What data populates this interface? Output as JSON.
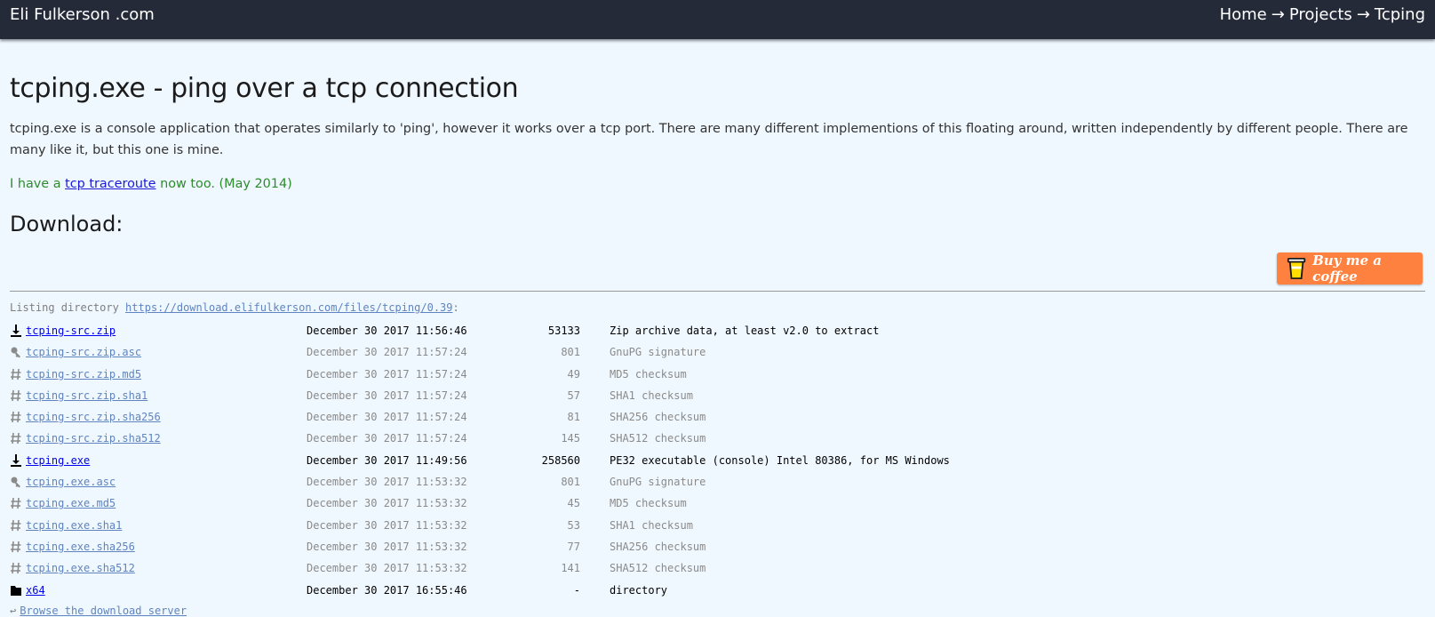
{
  "header": {
    "site_name": "Eli Fulkerson .com",
    "breadcrumbs": [
      "Home",
      "Projects",
      "Tcping"
    ],
    "separator": "→"
  },
  "page": {
    "title": "tcping.exe - ping over a tcp connection",
    "intro": "tcping.exe is a console application that operates similarly to 'ping', however it works over a tcp port. There are many different implementions of this floating around, written independently by different people. There are many like it, but this one is mine.",
    "note_prefix": "I have a ",
    "note_link": "tcp traceroute",
    "note_suffix": " now too. (May 2014)",
    "download_heading": "Download:",
    "coffee_label": "Buy me a coffee"
  },
  "listing": {
    "prefix": "Listing directory ",
    "url": "https://download.elifulkerson.com/files/tcping/0.39",
    "suffix": ":",
    "browse_arrow": "↩",
    "browse_label": "Browse the download server"
  },
  "files": [
    {
      "icon": "download-icon",
      "name": "tcping-src.zip",
      "date": "December 30 2017 11:56:46",
      "size": "53133",
      "desc": "Zip archive data, at least v2.0 to extract",
      "kind": "primary"
    },
    {
      "icon": "key-icon",
      "name": "tcping-src.zip.asc",
      "date": "December 30 2017 11:57:24",
      "size": "801",
      "desc": "GnuPG signature",
      "kind": "secondary"
    },
    {
      "icon": "hash-icon",
      "name": "tcping-src.zip.md5",
      "date": "December 30 2017 11:57:24",
      "size": "49",
      "desc": "MD5 checksum",
      "kind": "secondary"
    },
    {
      "icon": "hash-icon",
      "name": "tcping-src.zip.sha1",
      "date": "December 30 2017 11:57:24",
      "size": "57",
      "desc": "SHA1 checksum",
      "kind": "secondary"
    },
    {
      "icon": "hash-icon",
      "name": "tcping-src.zip.sha256",
      "date": "December 30 2017 11:57:24",
      "size": "81",
      "desc": "SHA256 checksum",
      "kind": "secondary"
    },
    {
      "icon": "hash-icon",
      "name": "tcping-src.zip.sha512",
      "date": "December 30 2017 11:57:24",
      "size": "145",
      "desc": "SHA512 checksum",
      "kind": "secondary"
    },
    {
      "icon": "download-icon",
      "name": "tcping.exe",
      "date": "December 30 2017 11:49:56",
      "size": "258560",
      "desc": "PE32 executable (console) Intel 80386, for MS Windows",
      "kind": "primary"
    },
    {
      "icon": "key-icon",
      "name": "tcping.exe.asc",
      "date": "December 30 2017 11:53:32",
      "size": "801",
      "desc": "GnuPG signature",
      "kind": "secondary"
    },
    {
      "icon": "hash-icon",
      "name": "tcping.exe.md5",
      "date": "December 30 2017 11:53:32",
      "size": "45",
      "desc": "MD5 checksum",
      "kind": "secondary"
    },
    {
      "icon": "hash-icon",
      "name": "tcping.exe.sha1",
      "date": "December 30 2017 11:53:32",
      "size": "53",
      "desc": "SHA1 checksum",
      "kind": "secondary"
    },
    {
      "icon": "hash-icon",
      "name": "tcping.exe.sha256",
      "date": "December 30 2017 11:53:32",
      "size": "77",
      "desc": "SHA256 checksum",
      "kind": "secondary"
    },
    {
      "icon": "hash-icon",
      "name": "tcping.exe.sha512",
      "date": "December 30 2017 11:53:32",
      "size": "141",
      "desc": "SHA512 checksum",
      "kind": "secondary"
    },
    {
      "icon": "folder-icon",
      "name": "x64",
      "date": "December 30 2017 16:55:46",
      "size": "-",
      "desc": "directory",
      "kind": "primary"
    }
  ],
  "colors": {
    "header_bg": "#252a39",
    "page_bg": "#f0f8ff",
    "note_green": "#2e8b2e",
    "coffee_orange": "#ff813f",
    "link_blue": "#0000ee",
    "muted_link": "#5f84c0"
  }
}
